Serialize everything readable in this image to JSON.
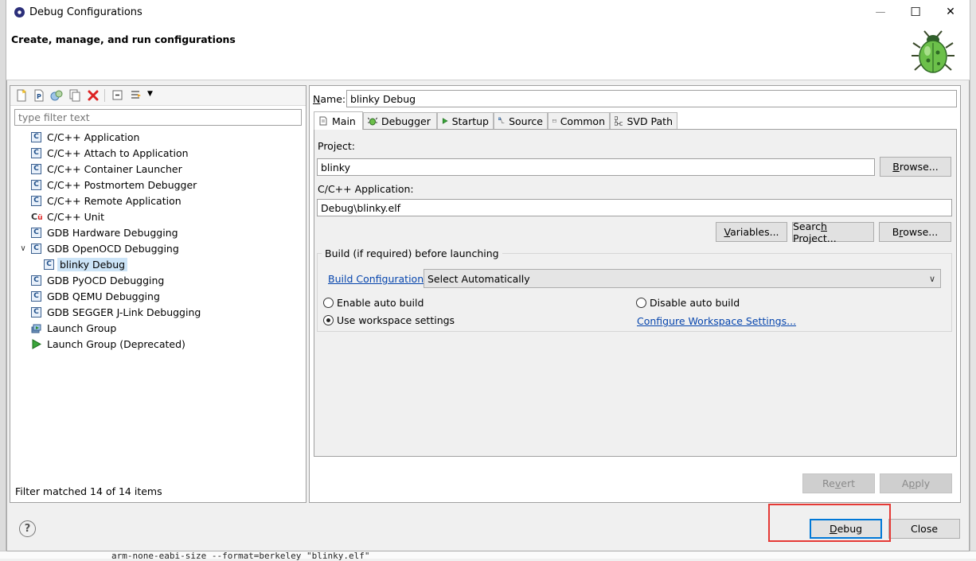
{
  "window": {
    "title": "Debug Configurations",
    "controls": {
      "minimize": "—",
      "maximize": "☐",
      "close": "✕"
    }
  },
  "banner": {
    "title": "Create, manage, and run configurations"
  },
  "sidebar": {
    "filter_placeholder": "type filter text",
    "status": "Filter matched 14 of 14 items",
    "items": [
      {
        "label": "C/C++ Application",
        "icon": "c-config-icon"
      },
      {
        "label": "C/C++ Attach to Application",
        "icon": "c-config-icon"
      },
      {
        "label": "C/C++ Container Launcher",
        "icon": "c-config-icon"
      },
      {
        "label": "C/C++ Postmortem Debugger",
        "icon": "c-config-icon"
      },
      {
        "label": "C/C++ Remote Application",
        "icon": "c-config-icon"
      },
      {
        "label": "C/C++ Unit",
        "icon": "cunit-icon"
      },
      {
        "label": "GDB Hardware Debugging",
        "icon": "c-config-icon"
      },
      {
        "label": "GDB OpenOCD Debugging",
        "icon": "c-config-icon",
        "expanded": true
      },
      {
        "label": "blinky Debug",
        "icon": "c-config-icon",
        "selected": true,
        "child": true
      },
      {
        "label": "GDB PyOCD Debugging",
        "icon": "c-config-icon"
      },
      {
        "label": "GDB QEMU Debugging",
        "icon": "c-config-icon"
      },
      {
        "label": "GDB SEGGER J-Link Debugging",
        "icon": "c-config-icon"
      },
      {
        "label": "Launch Group",
        "icon": "launch-group-icon"
      },
      {
        "label": "Launch Group (Deprecated)",
        "icon": "run-arrow-icon"
      }
    ]
  },
  "config": {
    "name_label": "Name:",
    "name_value": "blinky Debug",
    "tabs": [
      {
        "label": "Main",
        "active": true
      },
      {
        "label": "Debugger"
      },
      {
        "label": "Startup"
      },
      {
        "label": "Source"
      },
      {
        "label": "Common"
      },
      {
        "label": "SVD Path"
      }
    ],
    "main": {
      "project_label": "Project:",
      "project_value": "blinky",
      "browse_label": "Browse...",
      "app_label": "C/C++ Application:",
      "app_value": "Debug\\blinky.elf",
      "variables_label": "Variables...",
      "search_project_label": "Search Project...",
      "browse2_label": "Browse...",
      "build_group_title": "Build (if required) before launching",
      "build_config_link": "Build Configuration:",
      "build_config_value": "Select Automatically",
      "enable_auto_build": "Enable auto build",
      "disable_auto_build": "Disable auto build",
      "use_workspace": "Use workspace settings",
      "configure_workspace": "Configure Workspace Settings..."
    },
    "revert_label": "Revert",
    "apply_label": "Apply"
  },
  "footer": {
    "help_label": "?",
    "debug_label": "Debug",
    "close_label": "Close"
  },
  "background": {
    "console_text": "arm-none-eabi-size --format=berkeley \"blinky.elf\""
  },
  "colors": {
    "accent": "#0078d7",
    "selection": "#cce4f7",
    "link": "#0645ad",
    "highlight_box": "#e53935"
  }
}
